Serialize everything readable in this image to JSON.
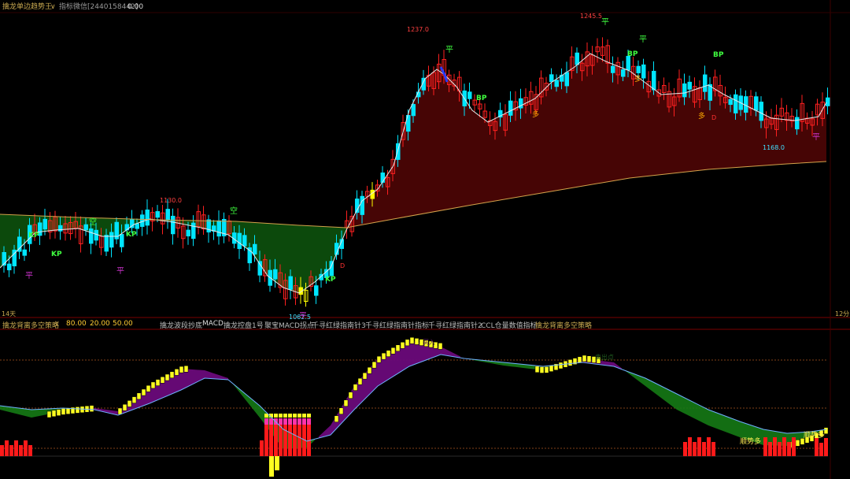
{
  "header": {
    "title": "擒龙单边趋势王",
    "separator": "∨",
    "indicator_label": "指标微信[2440158442]",
    "indicator_value": "0.00"
  },
  "price_panel": {
    "high_labels": [
      "1237.0",
      "1245.5",
      "1130.0"
    ],
    "low_labels": [
      "1062.5",
      "1168.0"
    ],
    "signals": {
      "ping": "平",
      "kp": "KP",
      "bp": "BP",
      "kong": "空",
      "duo": "多",
      "d": "D"
    },
    "left_bottom": "14天",
    "right_bottom": "12分"
  },
  "sub_panel": {
    "strategy": "擒龙背离多空策略",
    "dropdown": "∨",
    "params": [
      "80.00",
      "20.00",
      "50.00"
    ],
    "tabs": [
      "擒龙波段抄底",
      "MACD",
      "擒龙控盘1号",
      "聚宝MACD拐点",
      "千寻红绿指南针3",
      "千寻红绿指南针指标",
      "千寻红绿指南针2",
      "CCL仓量数值指标",
      "擒龙背离多空策略"
    ],
    "annotations": {
      "mid_top": "买入",
      "mid_right": "卖出点",
      "right": "顺势多",
      "right2": "顺势多"
    }
  },
  "colors": {
    "bear_candle": "#00e5ff",
    "bull_candle": "#ff2020",
    "yellow": "#ffff00",
    "green_cloud": "#0d4d0d",
    "red_cloud": "#4a0505",
    "purple": "#6a0a7a",
    "label_red": "#ff4040",
    "label_cyan": "#40e0ff",
    "label_green": "#40ff40",
    "label_magenta": "#cc33cc",
    "label_orange": "#ffaa00"
  }
}
